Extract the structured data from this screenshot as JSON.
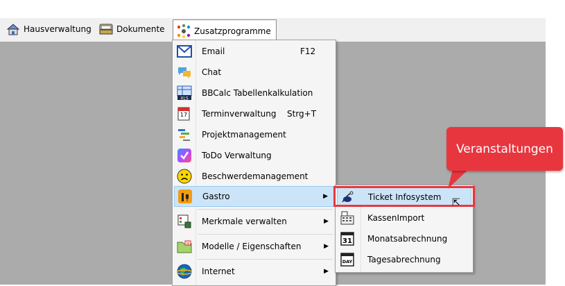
{
  "menubar": {
    "items": [
      {
        "label": "Hausverwaltung",
        "icon": "house-icon"
      },
      {
        "label": "Dokumente",
        "icon": "document-tray-icon"
      },
      {
        "label": "Zusatzprogramme",
        "icon": "gears-icon"
      }
    ]
  },
  "zusatz_menu": {
    "items": [
      {
        "label": "Email",
        "shortcut": "F12",
        "icon": "email-icon"
      },
      {
        "label": "Chat",
        "shortcut": "",
        "icon": "chat-icon"
      },
      {
        "label": "BBCalc Tabellenkalkulation",
        "shortcut": "",
        "icon": "spreadsheet-icon"
      },
      {
        "label": "Terminverwaltung",
        "shortcut": "Strg+T",
        "icon": "calendar-icon"
      },
      {
        "label": "Projektmanagement",
        "shortcut": "",
        "icon": "project-icon"
      },
      {
        "label": "ToDo Verwaltung",
        "shortcut": "",
        "icon": "todo-icon"
      },
      {
        "label": "Beschwerdemanagement",
        "shortcut": "",
        "icon": "complaint-face-icon"
      },
      {
        "label": "Gastro",
        "shortcut": "",
        "icon": "gastro-icon",
        "submenu": true
      },
      {
        "label": "Merkmale verwalten",
        "shortcut": "",
        "icon": "features-icon",
        "submenu": true
      },
      {
        "label": "Modelle / Eigenschaften",
        "shortcut": "",
        "icon": "models-folder-icon",
        "submenu": true
      },
      {
        "label": "Internet",
        "shortcut": "",
        "icon": "globe-icon",
        "submenu": true
      }
    ]
  },
  "gastro_submenu": {
    "items": [
      {
        "label": "Ticket Infosystem",
        "icon": "ticket-icon"
      },
      {
        "label": "KassenImport",
        "icon": "cash-register-icon"
      },
      {
        "label": "Monatsabrechnung",
        "icon": "calendar-31-icon"
      },
      {
        "label": "Tagesabrechnung",
        "icon": "day-calendar-icon"
      }
    ]
  },
  "annotation": {
    "text": "Veranstaltungen",
    "color": "#e8363f"
  },
  "colors": {
    "highlight": "#cce4f7",
    "canvas": "#ababab",
    "menu_bg": "#f5f5f5"
  }
}
